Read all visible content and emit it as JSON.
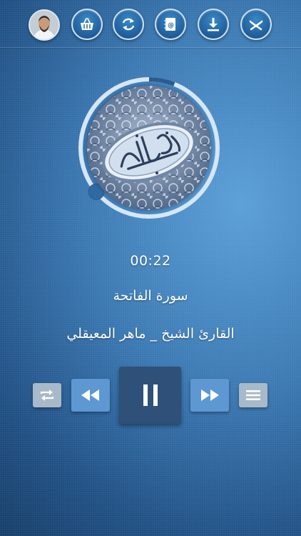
{
  "toolbar": {
    "items": [
      {
        "icon": "reciter-avatar"
      },
      {
        "icon": "basket-icon"
      },
      {
        "icon": "refresh-icon"
      },
      {
        "icon": "contacts-icon"
      },
      {
        "icon": "download-icon"
      },
      {
        "icon": "quran-book-icon"
      }
    ]
  },
  "player": {
    "artwork_icon": "quran-calligraphy-cover",
    "progress": 0.06,
    "time": "00:22",
    "surah": "سورة الفاتحة",
    "reciter": "القارئ الشيخ _ ماهر المعيقلي"
  },
  "controls": {
    "repeat": "repeat-icon",
    "rewind": "rewind-icon",
    "play_pause": "pause-icon",
    "forward": "fast-forward-icon",
    "playlist": "list-icon"
  },
  "colors": {
    "background": "#3b79b3",
    "toolbar_button": "#1f5d99",
    "play_button": "#2f5078",
    "skip_button": "#5d98d2",
    "side_button": "#a8b9c9"
  }
}
